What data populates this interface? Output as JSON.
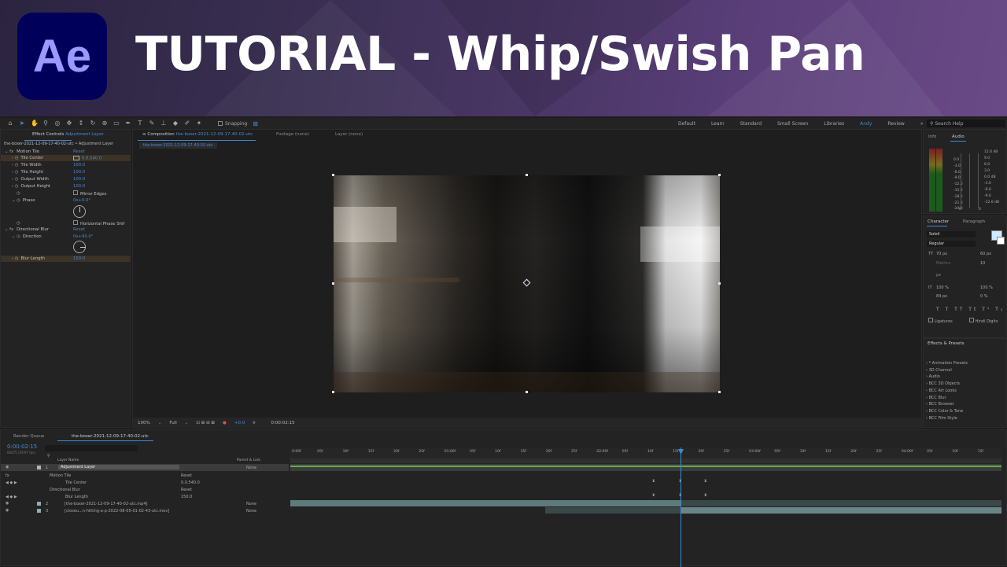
{
  "banner": {
    "logo_text": "Ae",
    "title": "TUTORIAL - Whip/Swish Pan"
  },
  "toolbar": {
    "snapping_label": "Snapping",
    "workspaces": [
      "Default",
      "Learn",
      "Standard",
      "Small Screen",
      "Libraries",
      "Andy",
      "Review"
    ],
    "active_workspace": "Andy",
    "search_placeholder": "Search Help"
  },
  "effect_controls": {
    "tab_label": "Effect Controls",
    "tab_target": "Adjustment Layer",
    "header": "the-boxer-2021-12-09-17-40-02-utc • Adjustment Layer",
    "rows": [
      {
        "label": "Motion Tile",
        "value": "Reset",
        "fx": true
      },
      {
        "label": "Tile Center",
        "value": "0.0,540.0"
      },
      {
        "label": "Tile Width",
        "value": "100.0"
      },
      {
        "label": "Tile Height",
        "value": "100.0"
      },
      {
        "label": "Output Width",
        "value": "100.0"
      },
      {
        "label": "Output Height",
        "value": "100.0"
      },
      {
        "label": "",
        "value": "Mirror Edges"
      },
      {
        "label": "Phase",
        "value": "0x+0.0°"
      },
      {
        "label": "",
        "value": "Horizontal Phase Shif"
      },
      {
        "label": "Directional Blur",
        "value": "Reset",
        "fx": true
      },
      {
        "label": "Direction",
        "value": "0x+90.0°"
      },
      {
        "label": "Blur Length",
        "value": "150.0"
      }
    ]
  },
  "composition": {
    "tab_label": "Composition",
    "tab_name": "the-boxer-2021-12-09-17-40-02-utc",
    "footage_tab": "Footage (none)",
    "layer_tab": "Layer (none)",
    "breadcrumb": "the-boxer-2021-12-09-17-40-02-utc",
    "zoom": "100%",
    "resolution": "Full",
    "exposure": "+0.0",
    "timecode": "0:00:02:15"
  },
  "info_panel": {
    "tabs": [
      "Info",
      "Audio"
    ],
    "active_tab": "Audio",
    "left_scale": [
      "0.0",
      "-3.0",
      "-6.0",
      "-9.0",
      "-12.0",
      "-15.0",
      "-18.0",
      "-21.0",
      "-24.0"
    ],
    "right_scale": [
      "12.0 dB",
      "6.0",
      "0.0 dB",
      "-6.0",
      "-12.0 dB"
    ],
    "mid_scale": [
      "9.0",
      "3.0",
      "-3.0",
      "-9.0"
    ],
    "bottom_values": [
      "0",
      "0"
    ]
  },
  "character": {
    "tabs": [
      "Character",
      "Paragraph"
    ],
    "font": "Soleil",
    "style": "Regular",
    "size": "70 px",
    "leading": "60 px",
    "kerning": "Metrics",
    "tracking": "10",
    "unit": "px",
    "vscale": "100 %",
    "hscale": "100 %",
    "baseline": "84 px",
    "tsume": "0 %",
    "ligatures": "Ligatures",
    "hindi": "Hindi Digits"
  },
  "effects_presets": {
    "title": "Effects & Presets",
    "items": [
      "* Animation Presets",
      "3D Channel",
      "Audio",
      "BCC 3D Objects",
      "BCC Art Looks",
      "BCC Blur",
      "BCC Browser",
      "BCC Color & Tone",
      "BCC Film Style"
    ]
  },
  "timeline": {
    "render_queue": "Render Queue",
    "comp_tab": "the-boxer-2021-12-09-17-40-02-utc",
    "timecode": "0:00:02:15",
    "frame_info": "00075 (29.97 fps)",
    "col_layer_name": "Layer Name",
    "col_parent": "Parent & Link",
    "ruler": [
      "0:00f",
      "05f",
      "10f",
      "15f",
      "20f",
      "25f",
      "01:00f",
      "05f",
      "10f",
      "15f",
      "20f",
      "25f",
      "02:00f",
      "05f",
      "10f",
      "15f",
      "20f",
      "25f",
      "03:00f",
      "05f",
      "10f",
      "15f",
      "20f",
      "25f",
      "04:00f",
      "05f",
      "10f",
      "15f"
    ],
    "layers": [
      {
        "num": "1",
        "name": "Adjustment Layer",
        "parent": "None",
        "color": "#b3b3b3"
      },
      {
        "num": "",
        "name": "Motion Tile",
        "value": "Reset"
      },
      {
        "num": "",
        "name": "Tile Center",
        "value": "0.0,540.0"
      },
      {
        "num": "",
        "name": "Directional Blur",
        "value": "Reset"
      },
      {
        "num": "",
        "name": "Blur Length",
        "value": "150.0"
      },
      {
        "num": "2",
        "name": "[the-boxer-2021-12-09-17-40-02-utc.mp4]",
        "parent": "None",
        "color": "#8ab0b0"
      },
      {
        "num": "3",
        "name": "[closeu...n-hitting-a-p-2022-08-05-01-02-43-utc.mov]",
        "parent": "None",
        "color": "#8ab0b0"
      }
    ]
  }
}
